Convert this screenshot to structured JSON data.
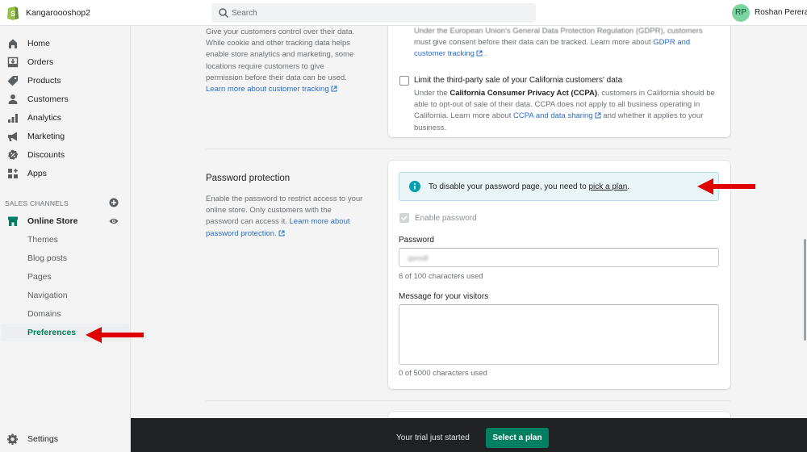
{
  "header": {
    "store_name": "Kangaroooshop2",
    "search_placeholder": "Search",
    "user_initials": "RP",
    "user_name": "Roshan Perera"
  },
  "sidebar": {
    "items": [
      {
        "label": "Home",
        "icon": "home-icon"
      },
      {
        "label": "Orders",
        "icon": "orders-icon"
      },
      {
        "label": "Products",
        "icon": "tag-icon"
      },
      {
        "label": "Customers",
        "icon": "person-icon"
      },
      {
        "label": "Analytics",
        "icon": "bar-chart-icon"
      },
      {
        "label": "Marketing",
        "icon": "megaphone-icon"
      },
      {
        "label": "Discounts",
        "icon": "discount-icon"
      },
      {
        "label": "Apps",
        "icon": "apps-icon"
      }
    ],
    "sales_channels_title": "SALES CHANNELS",
    "online_store": "Online Store",
    "sub_items": [
      "Themes",
      "Blog posts",
      "Pages",
      "Navigation",
      "Domains",
      "Preferences"
    ],
    "active_sub_item": "Preferences",
    "settings": "Settings"
  },
  "customer_privacy": {
    "description_lines": [
      "Give your customers control over their data.",
      "While cookie and other tracking data helps",
      "enable store analytics and marketing, some",
      "locations require customers to give",
      "permission before their data can be used."
    ],
    "learn_more_link": "Learn more about customer tracking",
    "gdpr_line_cut": "Under the European Union's General Data Protection Regulation (GDPR), customers",
    "gdpr_line2_prefix": "must give consent before their data can be tracked. Learn more about ",
    "gdpr_link_part1": "GDPR and",
    "gdpr_link_part2": "customer tracking",
    "gdpr_line3_suffix": " .",
    "ccpa_checkbox_label": "Limit the third-party sale of your California customers' data",
    "ccpa_checked": false,
    "ccpa_line1_prefix": "Under the ",
    "ccpa_bold": "California Consumer Privacy Act (CCPA)",
    "ccpa_line1_suffix": ", customers in California should be",
    "ccpa_line2": "able to opt-out of sale of their data. CCPA does not apply to all business operating in",
    "ccpa_line3_prefix": "California. Learn more about ",
    "ccpa_link": "CCPA and data sharing",
    "ccpa_line3_suffix": "  and whether it applies to your",
    "ccpa_line4": "business."
  },
  "password_protection": {
    "title": "Password protection",
    "description_lines": [
      "Enable the password to restrict access to your",
      "online store. Only customers with the",
      "password can access it. "
    ],
    "learn_more_part1": "Learn more about",
    "learn_more_part2": "password protection.",
    "banner_text": "To disable your password page, you need to ",
    "banner_link": "pick a plan",
    "banner_suffix": ".",
    "enable_password_label": "Enable password",
    "enable_password_checked": true,
    "password_label": "Password",
    "password_value": "qorodf",
    "password_help": "6 of 100 characters used",
    "message_label": "Message for your visitors",
    "message_value": "",
    "message_help": "0 of 5000 characters used"
  },
  "bottom_bar": {
    "trial_text": "Your trial just started",
    "select_plan": "Select a plan"
  },
  "colors": {
    "brand_green": "#008060",
    "active_nav": "#007f5f",
    "link_blue": "#2c6ecb",
    "annotation_red": "#e00000",
    "banner_bg": "#eaf5f8"
  }
}
